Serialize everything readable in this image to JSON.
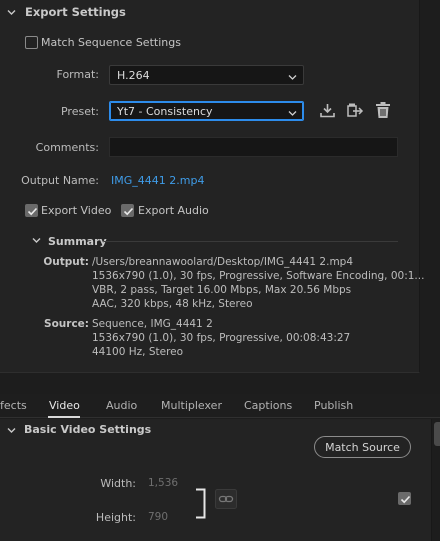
{
  "export_settings": {
    "title": "Export Settings",
    "match_sequence_label": "Match Sequence Settings",
    "match_sequence_checked": false,
    "format_label": "Format:",
    "format_value": "H.264",
    "preset_label": "Preset:",
    "preset_value": "Yt7 - Consistency",
    "comments_label": "Comments:",
    "comments_value": "",
    "output_name_label": "Output Name:",
    "output_name_value": "IMG_4441 2.mp4",
    "export_video_label": "Export Video",
    "export_video_checked": true,
    "export_audio_label": "Export Audio",
    "export_audio_checked": true
  },
  "summary": {
    "title": "Summary",
    "output_key": "Output:",
    "output_lines": [
      "/Users/breannawoolard/Desktop/IMG_4441 2.mp4",
      "1536x790 (1.0), 30 fps, Progressive, Software Encoding, 00:1...",
      "VBR, 2 pass, Target 16.00 Mbps, Max 20.56 Mbps",
      "AAC, 320 kbps, 48 kHz, Stereo"
    ],
    "source_key": "Source:",
    "source_lines": [
      "Sequence, IMG_4441 2",
      "1536x790 (1.0), 30 fps, Progressive, 00:08:43:27",
      "44100 Hz, Stereo"
    ]
  },
  "tabs": [
    "fects",
    "Video",
    "Audio",
    "Multiplexer",
    "Captions",
    "Publish"
  ],
  "active_tab": "Video",
  "basic_video": {
    "title": "Basic Video Settings",
    "match_source_label": "Match Source",
    "width_label": "Width:",
    "width_value": "1,536",
    "height_label": "Height:",
    "height_value": "790",
    "linked_checked": true
  },
  "icons": {
    "save_preset": "download-icon",
    "import_preset": "import-icon",
    "delete_preset": "trash-icon",
    "link": "chain-link-icon"
  },
  "colors": {
    "accent_blue": "#2d8ceb",
    "link_blue": "#3f9ce8",
    "panel_bg": "#232323"
  }
}
